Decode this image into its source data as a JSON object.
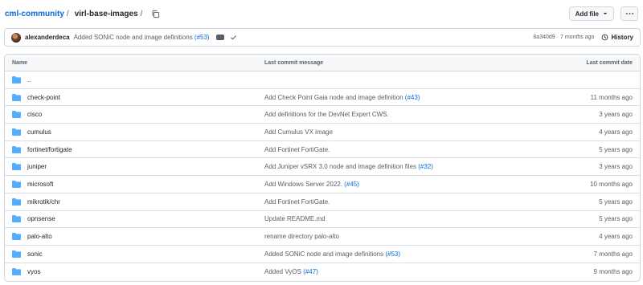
{
  "breadcrumb": {
    "owner": "cml-community",
    "repo": "virl-base-images",
    "separator": "/"
  },
  "toolbar": {
    "add_file_label": "Add file"
  },
  "latest_commit": {
    "author": "alexanderdeca",
    "message": "Added SONiC node and image definitions",
    "pr_ref": "(#53)",
    "sha": "8a340d9",
    "age": "7 months ago",
    "separator": "·",
    "history_label": "History"
  },
  "table": {
    "headers": {
      "name": "Name",
      "message": "Last commit message",
      "date": "Last commit date"
    },
    "parent_dir": "..",
    "rows": [
      {
        "name": "check-point",
        "msg": "Add Check Point Gaia node and image definition",
        "pr": "(#43)",
        "date": "11 months ago"
      },
      {
        "name": "cisco",
        "msg": "Add definitions for the DevNet Expert CWS.",
        "pr": "",
        "date": "3 years ago"
      },
      {
        "name": "cumulus",
        "msg": "Add Cumulus VX image",
        "pr": "",
        "date": "4 years ago"
      },
      {
        "name": "fortinet/fortigate",
        "msg": "Add Fortinet FortiGate.",
        "pr": "",
        "date": "5 years ago"
      },
      {
        "name": "juniper",
        "msg": "Add Juniper vSRX 3.0 node and image definition files",
        "pr": "(#32)",
        "date": "3 years ago"
      },
      {
        "name": "microsoft",
        "msg": "Add Windows Server 2022.",
        "pr": "(#45)",
        "date": "10 months ago"
      },
      {
        "name": "mikrotik/chr",
        "msg": "Add Fortinet FortiGate.",
        "pr": "",
        "date": "5 years ago"
      },
      {
        "name": "opnsense",
        "msg": "Update README.md",
        "pr": "",
        "date": "5 years ago"
      },
      {
        "name": "palo-alto",
        "msg": "rename directory palo-alto",
        "pr": "",
        "date": "4 years ago"
      },
      {
        "name": "sonic",
        "msg": "Added SONiC node and image definitions",
        "pr": "(#53)",
        "date": "7 months ago"
      },
      {
        "name": "vyos",
        "msg": "Added VyOS",
        "pr": "(#47)",
        "date": "9 months ago"
      }
    ]
  },
  "colors": {
    "link": "#0969da",
    "folder": "#54aeff",
    "muted": "#57606a"
  },
  "icons": {
    "copy": "copy-icon",
    "folder": "folder-icon",
    "history": "clock-history-icon",
    "check": "check-icon",
    "kebab": "kebab-horizontal-icon",
    "caret": "triangle-down-icon"
  }
}
